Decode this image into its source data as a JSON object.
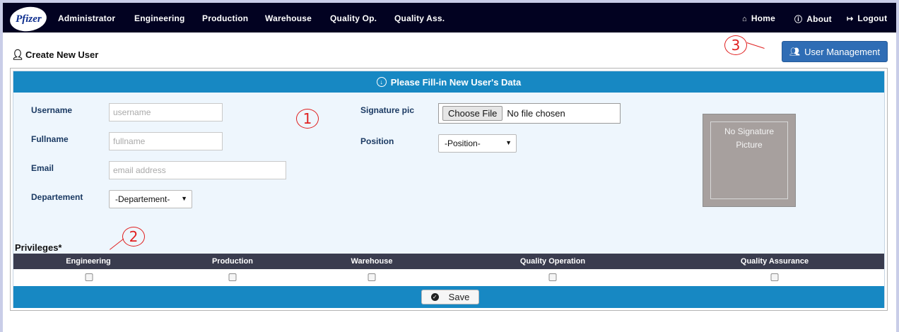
{
  "brand": {
    "logo_text": "Pfizer"
  },
  "nav": {
    "items": [
      "Administrator",
      "Engineering",
      "Production",
      "Warehouse",
      "Quality Op.",
      "Quality Ass."
    ],
    "right": [
      {
        "label": "Home",
        "icon": "home-icon"
      },
      {
        "label": "About",
        "icon": "info-icon"
      },
      {
        "label": "Logout",
        "icon": "logout-icon"
      }
    ]
  },
  "page": {
    "title": "Create New User",
    "title_icon": "add-user-icon",
    "user_management_button": "User Management",
    "user_management_icon": "users-icon"
  },
  "form": {
    "header": "Please Fill-in New User's Data",
    "header_icon": "circle-download-icon",
    "username": {
      "label": "Username",
      "placeholder": "username",
      "value": ""
    },
    "fullname": {
      "label": "Fullname",
      "placeholder": "fullname",
      "value": ""
    },
    "email": {
      "label": "Email",
      "placeholder": "email address",
      "value": ""
    },
    "department": {
      "label": "Departement",
      "selected": "-Departement-"
    },
    "signature": {
      "label": "Signature pic",
      "button": "Choose File",
      "status": "No file chosen"
    },
    "position": {
      "label": "Position",
      "selected": "-Position-"
    },
    "signature_preview": {
      "line1": "No Signature",
      "line2": "Picture"
    }
  },
  "privileges": {
    "label": "Privileges*",
    "columns": [
      "Engineering",
      "Production",
      "Warehouse",
      "Quality Operation",
      "Quality Assurance"
    ],
    "checked": [
      false,
      false,
      false,
      false,
      false
    ]
  },
  "actions": {
    "save": "Save"
  },
  "annotations": [
    "1",
    "2",
    "3"
  ],
  "colors": {
    "navbar": "#020221",
    "accent": "#1788c3",
    "button": "#2f6db5",
    "privileges_header": "#3a3c4e",
    "annotation": "#e02020",
    "signature_box": "#a7a09e"
  }
}
